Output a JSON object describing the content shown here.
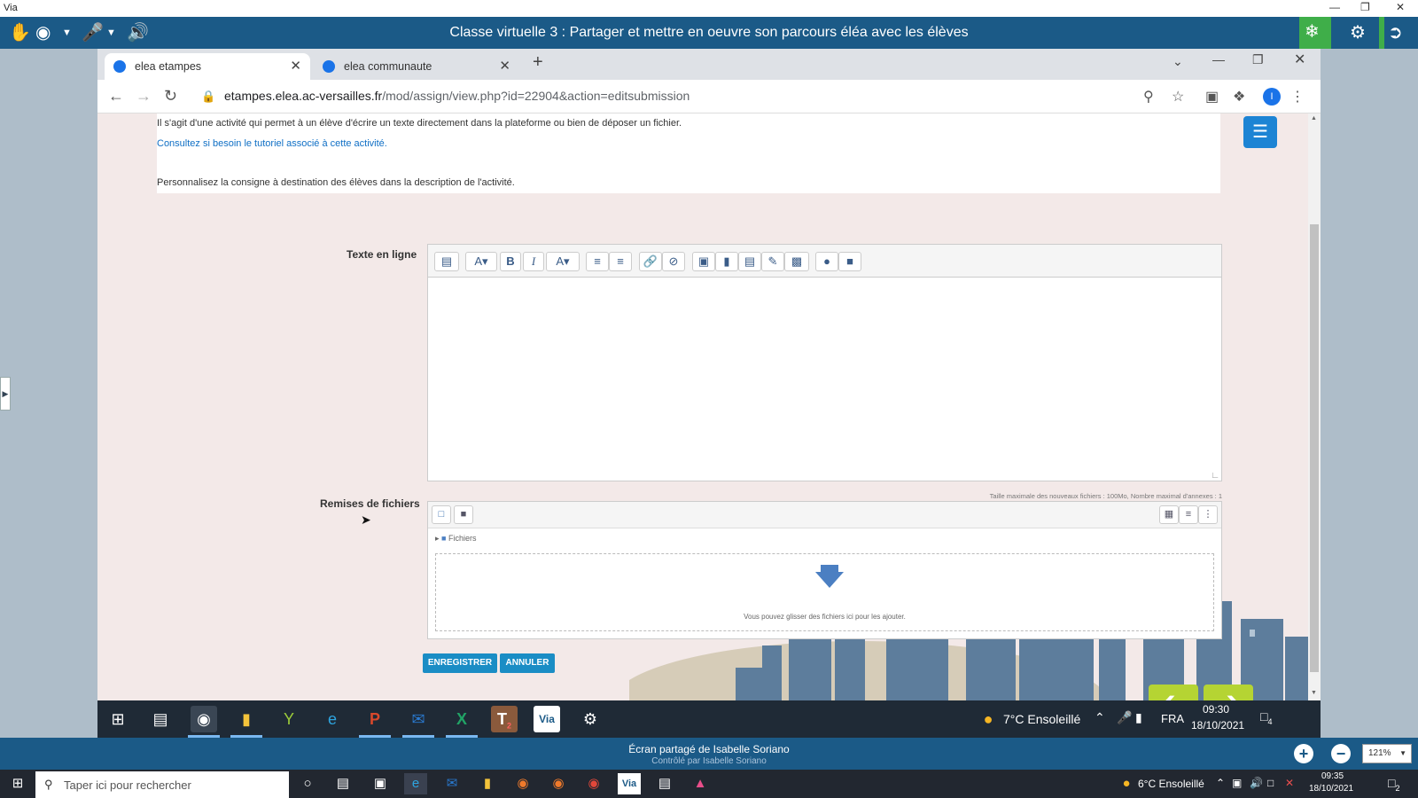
{
  "via": {
    "app_name": "Via",
    "title": "Classe virtuelle 3 : Partager et mettre en oeuvre son parcours éléa avec les élèves",
    "shared_screen": "Écran partagé de Isabelle Soriano",
    "controlled_by": "Contrôlé par Isabelle Soriano",
    "zoom": "121%"
  },
  "browser": {
    "tabs": [
      {
        "label": "elea etampes",
        "active": true
      },
      {
        "label": "elea communaute",
        "active": false
      }
    ],
    "url_host": "etampes.elea.ac-versailles.fr",
    "url_path": "/mod/assign/view.php?id=22904&action=editsubmission",
    "profile_initial": "I"
  },
  "page": {
    "intro_1": "Il s'agit d'une activité qui permet à un élève d'écrire un texte directement dans la plateforme ou bien de déposer un fichier.",
    "intro_link": "Consultez si besoin le tutoriel associé à cette activité.",
    "intro_2": "Personnalisez la consigne à destination des élèves dans la description de l'activité.",
    "online_text_label": "Texte en ligne",
    "file_submissions_label": "Remises de fichiers",
    "file_limits": "Taille maximale des nouveaux fichiers : 100Mo, Nombre maximal d'annexes : 1",
    "folder_label": "Fichiers",
    "drop_text": "Vous pouvez glisser des fichiers ici pour les ajouter.",
    "save_label": "ENREGISTRER",
    "cancel_label": "ANNULER"
  },
  "remote_taskbar": {
    "weather": "7°C  Ensoleillé",
    "lang": "FRA",
    "time": "09:30",
    "date": "18/10/2021",
    "teams_badge": "2",
    "notif_count": "4"
  },
  "local_taskbar": {
    "search_placeholder": "Taper ici pour rechercher",
    "weather": "6°C  Ensoleillé",
    "time": "09:35",
    "date": "18/10/2021",
    "notif_count": "2"
  },
  "colors": {
    "via_blue": "#1b5a87",
    "via_green": "#3fae49",
    "moodle_button": "#1a8dc5",
    "nav_arrow_green": "#b5d433"
  }
}
